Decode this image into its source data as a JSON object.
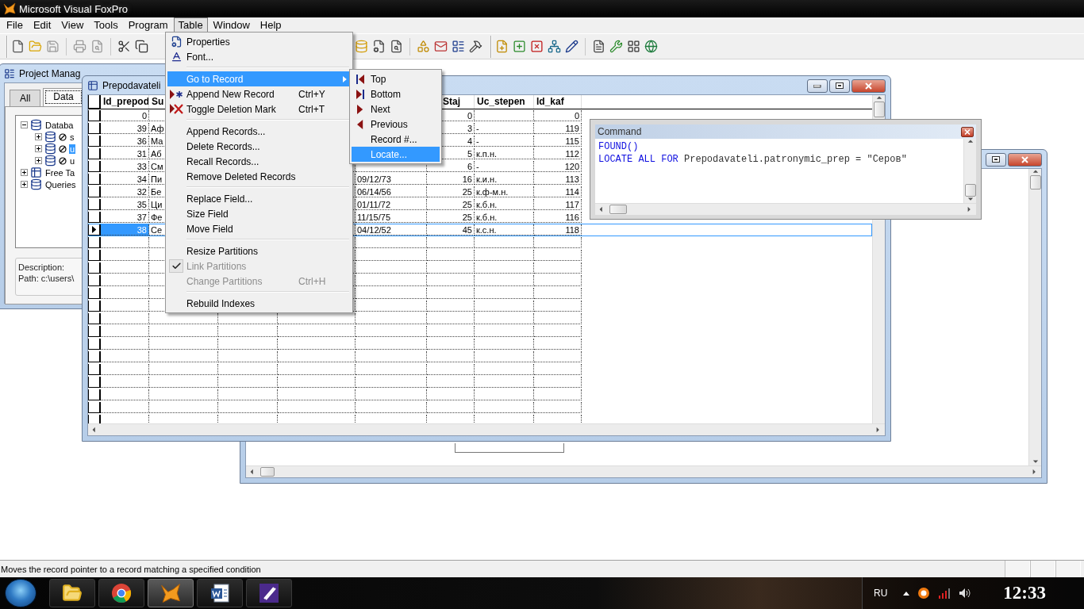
{
  "app_title": "Microsoft Visual FoxPro",
  "menubar": [
    {
      "label": "File",
      "selected": false
    },
    {
      "label": "Edit",
      "selected": false
    },
    {
      "label": "View",
      "selected": false
    },
    {
      "label": "Tools",
      "selected": false
    },
    {
      "label": "Program",
      "selected": false
    },
    {
      "label": "Table",
      "selected": true
    },
    {
      "label": "Window",
      "selected": false
    },
    {
      "label": "Help",
      "selected": false
    }
  ],
  "table_menu": [
    {
      "kind": "item",
      "label": "Properties",
      "selected": false,
      "disabled": false,
      "checked": false,
      "has_submenu": false
    },
    {
      "kind": "item",
      "label": "Font...",
      "selected": false,
      "disabled": false,
      "checked": false,
      "has_submenu": false
    },
    {
      "kind": "separator"
    },
    {
      "kind": "item",
      "label": "Go to Record",
      "selected": true,
      "disabled": false,
      "checked": false,
      "has_submenu": true
    },
    {
      "kind": "item",
      "label": "Append New Record",
      "shortcut": "Ctrl+Y",
      "selected": false,
      "disabled": false,
      "checked": false,
      "has_submenu": false
    },
    {
      "kind": "item",
      "label": "Toggle Deletion Mark",
      "shortcut": "Ctrl+T",
      "selected": false,
      "disabled": false,
      "checked": false,
      "has_submenu": false
    },
    {
      "kind": "separator"
    },
    {
      "kind": "item",
      "label": "Append Records...",
      "selected": false,
      "disabled": false,
      "checked": false,
      "has_submenu": false
    },
    {
      "kind": "item",
      "label": "Delete Records...",
      "selected": false,
      "disabled": false,
      "checked": false,
      "has_submenu": false
    },
    {
      "kind": "item",
      "label": "Recall Records...",
      "selected": false,
      "disabled": false,
      "checked": false,
      "has_submenu": false
    },
    {
      "kind": "item",
      "label": "Remove Deleted Records",
      "selected": false,
      "disabled": false,
      "checked": false,
      "has_submenu": false
    },
    {
      "kind": "separator"
    },
    {
      "kind": "item",
      "label": "Replace Field...",
      "selected": false,
      "disabled": false,
      "checked": false,
      "has_submenu": false
    },
    {
      "kind": "item",
      "label": "Size Field",
      "selected": false,
      "disabled": false,
      "checked": false,
      "has_submenu": false
    },
    {
      "kind": "item",
      "label": "Move Field",
      "selected": false,
      "disabled": false,
      "checked": false,
      "has_submenu": false
    },
    {
      "kind": "separator"
    },
    {
      "kind": "item",
      "label": "Resize Partitions",
      "selected": false,
      "disabled": false,
      "checked": false,
      "has_submenu": false
    },
    {
      "kind": "item",
      "label": "Link Partitions",
      "selected": false,
      "disabled": true,
      "checked": true,
      "has_submenu": false
    },
    {
      "kind": "item",
      "label": "Change Partitions",
      "shortcut": "Ctrl+H",
      "selected": false,
      "disabled": true,
      "checked": false,
      "has_submenu": false
    },
    {
      "kind": "separator"
    },
    {
      "kind": "item",
      "label": "Rebuild Indexes",
      "selected": false,
      "disabled": false,
      "checked": false,
      "has_submenu": false
    }
  ],
  "go_to_record_submenu": [
    {
      "label": "Top",
      "selected": false
    },
    {
      "label": "Bottom",
      "selected": false
    },
    {
      "label": "Next",
      "selected": false
    },
    {
      "label": "Previous",
      "selected": false
    },
    {
      "label": "Record #...",
      "selected": false
    },
    {
      "label": "Locate...",
      "selected": true
    }
  ],
  "project_manager": {
    "title": "Project Manag",
    "tabs": [
      {
        "label": "All",
        "selected": false
      },
      {
        "label": "Data",
        "selected": true
      }
    ],
    "tree": [
      {
        "label": "Databa",
        "expanded": true,
        "excluded": false,
        "selected": false,
        "children": [
          {
            "label": "s",
            "expanded": false,
            "excluded": true,
            "selected": false
          },
          {
            "label": "u",
            "expanded": false,
            "excluded": true,
            "selected": true
          },
          {
            "label": "u",
            "expanded": false,
            "excluded": true,
            "selected": false
          }
        ]
      },
      {
        "label": "Free Ta",
        "expanded": false,
        "excluded": false,
        "selected": false
      },
      {
        "label": "Queries",
        "expanded": false,
        "excluded": false,
        "selected": false
      }
    ],
    "description_label": "Description:",
    "path": "Path: c:\\users\\"
  },
  "browse": {
    "title": "Prepodavateli",
    "headers": {
      "id_prepod": "Id_prepod",
      "su": "Su",
      "staj": "Staj",
      "uc_stepen": "Uc_stepen",
      "id_kaf": "Id_kaf"
    },
    "rows": [
      {
        "id_prepod": "0",
        "staj": "0",
        "id_kaf": "0",
        "selected": false
      },
      {
        "id_prepod": "39",
        "su": "Аф",
        "staj": "3",
        "uc_stepen": "-",
        "id_kaf": "119",
        "selected": false
      },
      {
        "id_prepod": "36",
        "su": "Ма",
        "staj": "4",
        "uc_stepen": "-",
        "id_kaf": "115",
        "selected": false
      },
      {
        "id_prepod": "31",
        "su": "Аб",
        "staj": "5",
        "uc_stepen": "к.п.н.",
        "id_kaf": "112",
        "selected": false
      },
      {
        "id_prepod": "33",
        "su": "См",
        "staj": "6",
        "uc_stepen": "-",
        "id_kaf": "120",
        "selected": false
      },
      {
        "id_prepod": "34",
        "su": "Пи",
        "column_5": "09/12/73",
        "staj": "16",
        "uc_stepen": "к.и.н.",
        "id_kaf": "113",
        "selected": false
      },
      {
        "id_prepod": "32",
        "su": "Бе",
        "column_5": "06/14/56",
        "staj": "25",
        "uc_stepen": "к.ф-м.н.",
        "id_kaf": "114",
        "selected": false
      },
      {
        "id_prepod": "35",
        "su": "Ци",
        "column_5": "01/11/72",
        "staj": "25",
        "uc_stepen": "к.б.н.",
        "id_kaf": "117",
        "selected": false
      },
      {
        "id_prepod": "37",
        "su": "Фе",
        "column_5": "11/15/75",
        "staj": "25",
        "uc_stepen": "к.б.н.",
        "id_kaf": "116",
        "selected": false
      },
      {
        "id_prepod": "38",
        "su": "Се",
        "column_5": "04/12/52",
        "staj": "45",
        "uc_stepen": "к.с.н.",
        "id_kaf": "118",
        "selected": true
      }
    ]
  },
  "command_window": {
    "title": "Command",
    "lines": [
      [
        {
          "kind": "keyword",
          "text": "FOUND()"
        }
      ],
      [
        {
          "kind": "keyword",
          "text": "LOCATE ALL FOR"
        },
        {
          "kind": "plain",
          "text": " Prepodavateli.patronymic_prep = \"Серов\""
        }
      ]
    ]
  },
  "status_bar": {
    "message": "Moves the record pointer to a record matching a specified condition"
  },
  "taskbar": {
    "apps": [
      {
        "selected": false
      },
      {
        "selected": false
      },
      {
        "selected": true
      },
      {
        "selected": false
      },
      {
        "selected": false
      }
    ],
    "language": "RU",
    "clock": "12:33"
  }
}
